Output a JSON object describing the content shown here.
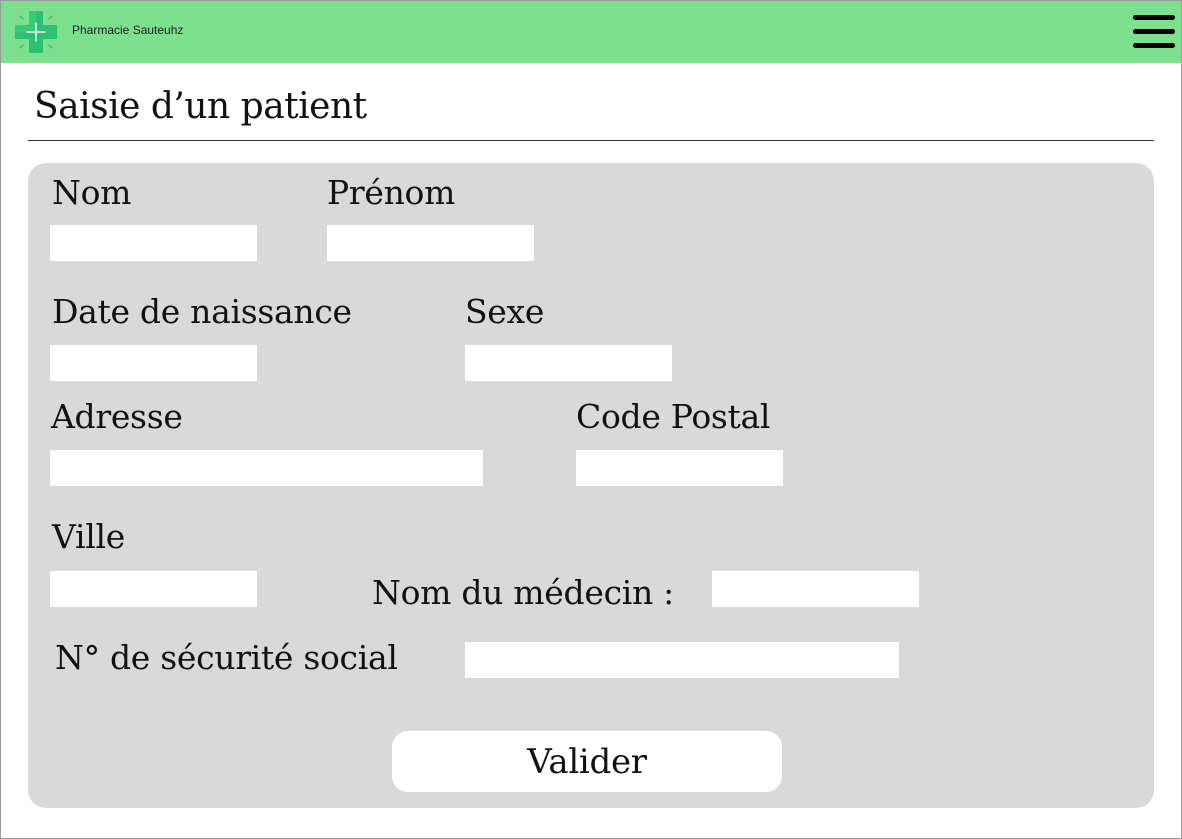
{
  "header": {
    "brand_name": "Pharmacie Sauteuhz",
    "logo_icon": "pharmacy-cross-icon",
    "menu_icon": "hamburger-menu-icon",
    "accent_color": "#7de08f",
    "logo_color": "#2fbf71"
  },
  "page": {
    "title": "Saisie d’un patient"
  },
  "form": {
    "background": "#d9d9d9",
    "fields": {
      "nom": {
        "label": "Nom",
        "value": ""
      },
      "prenom": {
        "label": "Prénom",
        "value": ""
      },
      "date_naissance": {
        "label": "Date de naissance",
        "value": ""
      },
      "sexe": {
        "label": "Sexe",
        "value": ""
      },
      "adresse": {
        "label": "Adresse",
        "value": ""
      },
      "code_postal": {
        "label": "Code Postal",
        "value": ""
      },
      "ville": {
        "label": "Ville",
        "value": ""
      },
      "medecin": {
        "label": "Nom du médecin :",
        "value": ""
      },
      "securite_sociale": {
        "label": "N° de sécurité social",
        "value": ""
      }
    },
    "submit_label": "Valider"
  }
}
